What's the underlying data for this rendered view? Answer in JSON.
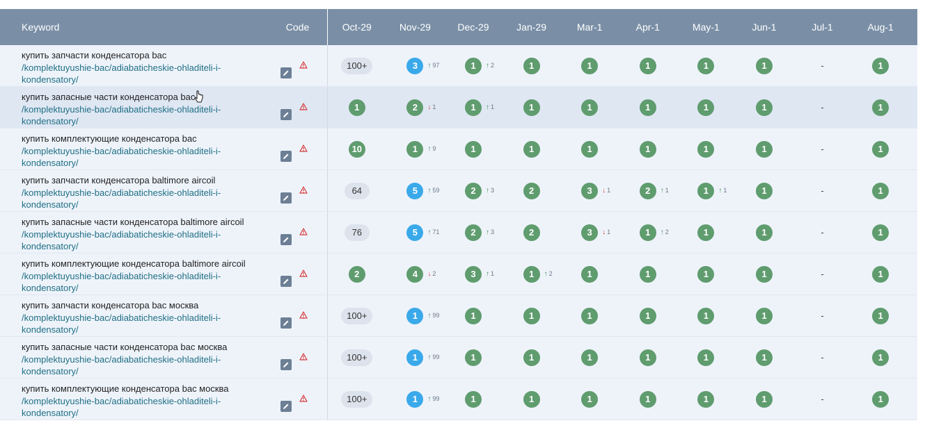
{
  "table": {
    "headers": {
      "keyword": "Keyword",
      "code": "Code",
      "dates": [
        "Oct-29",
        "Nov-29",
        "Dec-29",
        "Jan-29",
        "Mar-1",
        "Apr-1",
        "May-1",
        "Jun-1",
        "Jul-1",
        "Aug-1"
      ]
    },
    "rows": [
      {
        "keyword": "купить запчасти конденсатора bac",
        "url": "/komplektuyushie-bac/adiabaticheskie-ohladiteli-i-kondensatory/",
        "cells": [
          {
            "v": "100+",
            "c": "gr"
          },
          {
            "v": "3",
            "c": "b",
            "d": "97",
            "dir": "up"
          },
          {
            "v": "1",
            "c": "g",
            "d": "2",
            "dir": "up"
          },
          {
            "v": "1",
            "c": "g"
          },
          {
            "v": "1",
            "c": "g"
          },
          {
            "v": "1",
            "c": "g"
          },
          {
            "v": "1",
            "c": "g"
          },
          {
            "v": "1",
            "c": "g"
          },
          {
            "v": "-",
            "c": "dash"
          },
          {
            "v": "1",
            "c": "g"
          }
        ]
      },
      {
        "keyword": "купить запасные части конденсатора bac",
        "url": "/komplektuyushie-bac/adiabaticheskie-ohladiteli-i-kondensatory/",
        "hover": true,
        "cells": [
          {
            "v": "1",
            "c": "g"
          },
          {
            "v": "2",
            "c": "g",
            "d": "1",
            "dir": "down"
          },
          {
            "v": "1",
            "c": "g",
            "d": "1",
            "dir": "up"
          },
          {
            "v": "1",
            "c": "g"
          },
          {
            "v": "1",
            "c": "g"
          },
          {
            "v": "1",
            "c": "g"
          },
          {
            "v": "1",
            "c": "g"
          },
          {
            "v": "1",
            "c": "g"
          },
          {
            "v": "-",
            "c": "dash"
          },
          {
            "v": "1",
            "c": "g"
          }
        ]
      },
      {
        "keyword": "купить комплектующие конденсатора bac",
        "url": "/komplektuyushie-bac/adiabaticheskie-ohladiteli-i-kondensatory/",
        "cells": [
          {
            "v": "10",
            "c": "g"
          },
          {
            "v": "1",
            "c": "g",
            "d": "9",
            "dir": "up"
          },
          {
            "v": "1",
            "c": "g"
          },
          {
            "v": "1",
            "c": "g"
          },
          {
            "v": "1",
            "c": "g"
          },
          {
            "v": "1",
            "c": "g"
          },
          {
            "v": "1",
            "c": "g"
          },
          {
            "v": "1",
            "c": "g"
          },
          {
            "v": "-",
            "c": "dash"
          },
          {
            "v": "1",
            "c": "g"
          }
        ]
      },
      {
        "keyword": "купить запчасти конденсатора baltimore aircoil",
        "url": "/komplektuyushie-bac/adiabaticheskie-ohladiteli-i-kondensatory/",
        "cells": [
          {
            "v": "64",
            "c": "gr"
          },
          {
            "v": "5",
            "c": "b",
            "d": "59",
            "dir": "up"
          },
          {
            "v": "2",
            "c": "g",
            "d": "3",
            "dir": "up"
          },
          {
            "v": "2",
            "c": "g"
          },
          {
            "v": "3",
            "c": "g",
            "d": "1",
            "dir": "down"
          },
          {
            "v": "2",
            "c": "g",
            "d": "1",
            "dir": "up"
          },
          {
            "v": "1",
            "c": "g",
            "d": "1",
            "dir": "up"
          },
          {
            "v": "1",
            "c": "g"
          },
          {
            "v": "-",
            "c": "dash"
          },
          {
            "v": "1",
            "c": "g"
          }
        ]
      },
      {
        "keyword": "купить запасные части конденсатора baltimore aircoil",
        "url": "/komplektuyushie-bac/adiabaticheskie-ohladiteli-i-kondensatory/",
        "cells": [
          {
            "v": "76",
            "c": "gr"
          },
          {
            "v": "5",
            "c": "b",
            "d": "71",
            "dir": "up"
          },
          {
            "v": "2",
            "c": "g",
            "d": "3",
            "dir": "up"
          },
          {
            "v": "2",
            "c": "g"
          },
          {
            "v": "3",
            "c": "g",
            "d": "1",
            "dir": "down"
          },
          {
            "v": "1",
            "c": "g",
            "d": "2",
            "dir": "up"
          },
          {
            "v": "1",
            "c": "g"
          },
          {
            "v": "1",
            "c": "g"
          },
          {
            "v": "-",
            "c": "dash"
          },
          {
            "v": "1",
            "c": "g"
          }
        ]
      },
      {
        "keyword": "купить комплектующие конденсатора baltimore aircoil",
        "url": "/komplektuyushie-bac/adiabaticheskie-ohladiteli-i-kondensatory/",
        "cells": [
          {
            "v": "2",
            "c": "g"
          },
          {
            "v": "4",
            "c": "g",
            "d": "2",
            "dir": "down"
          },
          {
            "v": "3",
            "c": "g",
            "d": "1",
            "dir": "up"
          },
          {
            "v": "1",
            "c": "g",
            "d": "2",
            "dir": "up"
          },
          {
            "v": "1",
            "c": "g"
          },
          {
            "v": "1",
            "c": "g"
          },
          {
            "v": "1",
            "c": "g"
          },
          {
            "v": "1",
            "c": "g"
          },
          {
            "v": "-",
            "c": "dash"
          },
          {
            "v": "1",
            "c": "g"
          }
        ]
      },
      {
        "keyword": "купить запчасти конденсатора bac москва",
        "url": "/komplektuyushie-bac/adiabaticheskie-ohladiteli-i-kondensatory/",
        "cells": [
          {
            "v": "100+",
            "c": "gr"
          },
          {
            "v": "1",
            "c": "b",
            "d": "99",
            "dir": "up"
          },
          {
            "v": "1",
            "c": "g"
          },
          {
            "v": "1",
            "c": "g"
          },
          {
            "v": "1",
            "c": "g"
          },
          {
            "v": "1",
            "c": "g"
          },
          {
            "v": "1",
            "c": "g"
          },
          {
            "v": "1",
            "c": "g"
          },
          {
            "v": "-",
            "c": "dash"
          },
          {
            "v": "1",
            "c": "g"
          }
        ]
      },
      {
        "keyword": "купить запасные части конденсатора bac москва",
        "url": "/komplektuyushie-bac/adiabaticheskie-ohladiteli-i-kondensatory/",
        "cells": [
          {
            "v": "100+",
            "c": "gr"
          },
          {
            "v": "1",
            "c": "b",
            "d": "99",
            "dir": "up"
          },
          {
            "v": "1",
            "c": "g"
          },
          {
            "v": "1",
            "c": "g"
          },
          {
            "v": "1",
            "c": "g"
          },
          {
            "v": "1",
            "c": "g"
          },
          {
            "v": "1",
            "c": "g"
          },
          {
            "v": "1",
            "c": "g"
          },
          {
            "v": "-",
            "c": "dash"
          },
          {
            "v": "1",
            "c": "g"
          }
        ]
      },
      {
        "keyword": "купить комплектующие конденсатора bac москва",
        "url": "/komplektuyushie-bac/adiabaticheskie-ohladiteli-i-kondensatory/",
        "cells": [
          {
            "v": "100+",
            "c": "gr"
          },
          {
            "v": "1",
            "c": "b",
            "d": "99",
            "dir": "up"
          },
          {
            "v": "1",
            "c": "g"
          },
          {
            "v": "1",
            "c": "g"
          },
          {
            "v": "1",
            "c": "g"
          },
          {
            "v": "1",
            "c": "g"
          },
          {
            "v": "1",
            "c": "g"
          },
          {
            "v": "1",
            "c": "g"
          },
          {
            "v": "-",
            "c": "dash"
          },
          {
            "v": "1",
            "c": "g"
          }
        ]
      }
    ]
  },
  "icons": {
    "edit": "pencil-icon",
    "warning": "warning-triangle-icon",
    "up": "arrow-up-icon",
    "down": "arrow-down-icon",
    "cursor": "text-cursor-icon"
  },
  "colors": {
    "header_bg": "#7a8fa6",
    "row_bg": "#eef3fa",
    "row_hover_bg": "#dfe7f3",
    "badge_green": "#5f9c6e",
    "badge_blue": "#3aa9ea",
    "badge_gray": "#dde3ec",
    "url": "#1f6f84",
    "warning": "#d63b3b"
  }
}
